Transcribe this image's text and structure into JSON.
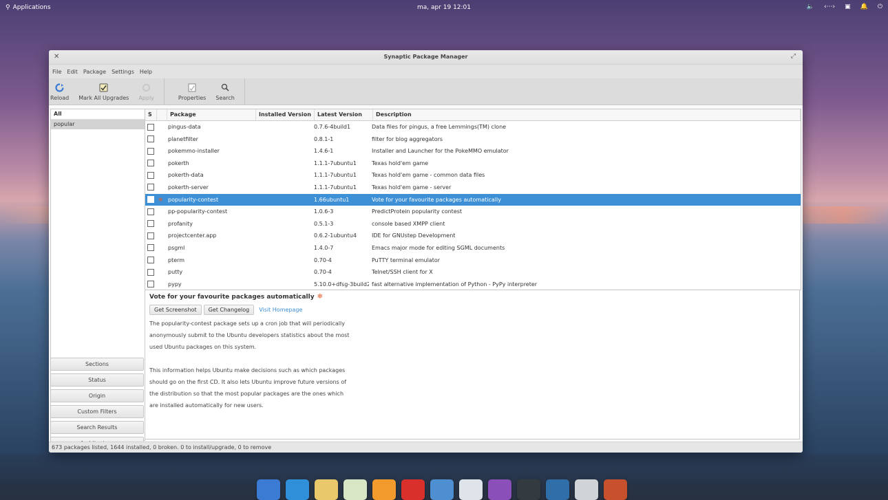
{
  "panel": {
    "apps_label": "Applications",
    "clock": "ma, apr 19   12:01"
  },
  "window": {
    "title": "Synaptic Package Manager"
  },
  "menu": [
    "File",
    "Edit",
    "Package",
    "Settings",
    "Help"
  ],
  "toolbar": {
    "reload": "Reload",
    "mark_all": "Mark All Upgrades",
    "apply": "Apply",
    "properties": "Properties",
    "search": "Search"
  },
  "sidebar": {
    "header": "All",
    "items": [
      "popular"
    ],
    "buttons": [
      "Sections",
      "Status",
      "Origin",
      "Custom Filters",
      "Search Results",
      "Architecture"
    ]
  },
  "table": {
    "headers": {
      "s": "S",
      "package": "Package",
      "installed": "Installed Version",
      "latest": "Latest Version",
      "description": "Description"
    },
    "rows": [
      {
        "name": "pingus-data",
        "installed": "",
        "latest": "0.7.6-4build1",
        "desc": "Data files for pingus, a free Lemmings(TM) clone"
      },
      {
        "name": "planetfilter",
        "installed": "",
        "latest": "0.8.1-1",
        "desc": "filter for blog aggregators"
      },
      {
        "name": "pokemmo-installer",
        "installed": "",
        "latest": "1.4.6-1",
        "desc": "Installer and Launcher for the PokeMMO emulator"
      },
      {
        "name": "pokerth",
        "installed": "",
        "latest": "1.1.1-7ubuntu1",
        "desc": "Texas hold'em game"
      },
      {
        "name": "pokerth-data",
        "installed": "",
        "latest": "1.1.1-7ubuntu1",
        "desc": "Texas hold'em game - common data files"
      },
      {
        "name": "pokerth-server",
        "installed": "",
        "latest": "1.1.1-7ubuntu1",
        "desc": "Texas hold'em game - server"
      },
      {
        "name": "popularity-contest",
        "installed": "",
        "latest": "1.66ubuntu1",
        "desc": "Vote for your favourite packages automatically"
      },
      {
        "name": "pp-popularity-contest",
        "installed": "",
        "latest": "1.0.6-3",
        "desc": "PredictProtein popularity contest"
      },
      {
        "name": "profanity",
        "installed": "",
        "latest": "0.5.1-3",
        "desc": "console based XMPP client"
      },
      {
        "name": "projectcenter.app",
        "installed": "",
        "latest": "0.6.2-1ubuntu4",
        "desc": "IDE for GNUstep Development"
      },
      {
        "name": "psgml",
        "installed": "",
        "latest": "1.4.0-7",
        "desc": "Emacs major mode for editing SGML documents"
      },
      {
        "name": "pterm",
        "installed": "",
        "latest": "0.70-4",
        "desc": "PuTTY terminal emulator"
      },
      {
        "name": "putty",
        "installed": "",
        "latest": "0.70-4",
        "desc": "Telnet/SSH client for X"
      },
      {
        "name": "pypy",
        "installed": "",
        "latest": "5.10.0+dfsg-3build2",
        "desc": "fast alternative implementation of Python - PyPy interpreter"
      }
    ]
  },
  "detail": {
    "heading": "Vote for your favourite packages automatically",
    "get_screenshot": "Get Screenshot",
    "get_changelog": "Get Changelog",
    "visit_homepage": "Visit Homepage",
    "para1": "The popularity-contest package sets up a cron job that will periodically anonymously submit to the Ubuntu developers statistics about the most used Ubuntu packages on this system.",
    "para2": "This information helps Ubuntu make decisions such as which packages should go on the first CD. It also lets Ubuntu improve future versions of the distribution so that the most popular packages are the ones which are installed automatically for new users."
  },
  "status": "673 packages listed, 1644 installed, 0 broken. 0 to install/upgrade, 0 to remove",
  "dock_items": [
    {
      "name": "multitasking-view-icon",
      "color": "#3b7bd4"
    },
    {
      "name": "web-browser-icon",
      "color": "#2f8fd8"
    },
    {
      "name": "mail-icon",
      "color": "#e8c86a"
    },
    {
      "name": "calendar-icon",
      "color": "#d9e6c5"
    },
    {
      "name": "music-icon",
      "color": "#f39a2c"
    },
    {
      "name": "videos-icon",
      "color": "#d9302c"
    },
    {
      "name": "photos-icon",
      "color": "#4d8fd0"
    },
    {
      "name": "settings-toggle-icon",
      "color": "#dfe4ea"
    },
    {
      "name": "appcenter-icon",
      "color": "#8a4fb8"
    },
    {
      "name": "terminal-icon",
      "color": "#333a40"
    },
    {
      "name": "screenshot-icon",
      "color": "#2f6ea8"
    },
    {
      "name": "files-icon",
      "color": "#d0d4d8"
    },
    {
      "name": "synaptic-icon",
      "color": "#c7512c"
    }
  ],
  "selected_row": 6
}
